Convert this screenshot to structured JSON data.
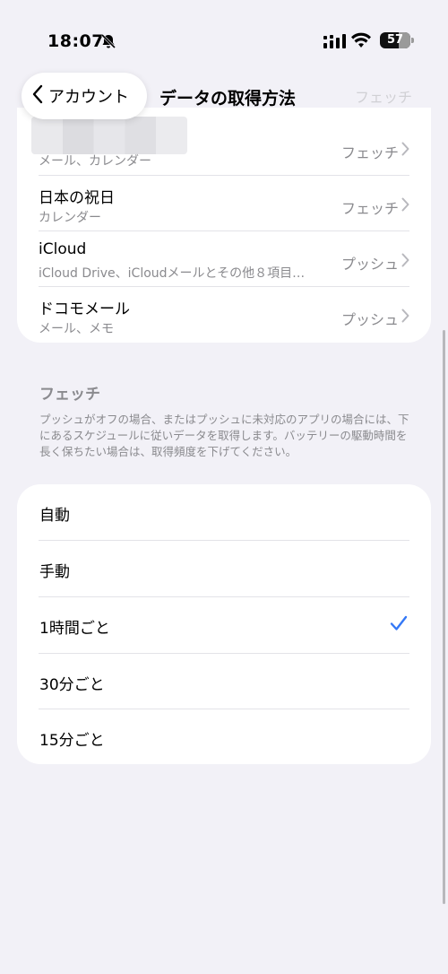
{
  "status_bar": {
    "time": "18:07",
    "battery": "57"
  },
  "nav": {
    "back_label": "アカウント",
    "title": "データの取得方法",
    "ghost_value": "フェッチ"
  },
  "accounts": [
    {
      "title": "",
      "subtitle": "メール、カレンダー",
      "value": "フェッチ"
    },
    {
      "title": "日本の祝日",
      "subtitle": "カレンダー",
      "value": "フェッチ"
    },
    {
      "title": "iCloud",
      "subtitle": "iCloud Drive、iCloudメールとその他８項目…",
      "value": "プッシュ"
    },
    {
      "title": "ドコモメール",
      "subtitle": "メール、メモ",
      "value": "プッシュ"
    }
  ],
  "fetch_section": {
    "title": "フェッチ",
    "description": "プッシュがオフの場合、またはプッシュに未対応のアプリの場合には、下にあるスケジュールに従いデータを取得します。バッテリーの駆動時間を長く保ちたい場合は、取得頻度を下げてください。"
  },
  "fetch_options": [
    {
      "label": "自動",
      "selected": false
    },
    {
      "label": "手動",
      "selected": false
    },
    {
      "label": "1時間ごと",
      "selected": true
    },
    {
      "label": "30分ごと",
      "selected": false
    },
    {
      "label": "15分ごと",
      "selected": false
    }
  ],
  "colors": {
    "accent": "#3478f6",
    "background": "#f2f1f7",
    "secondary_text": "#8a8a8e"
  }
}
